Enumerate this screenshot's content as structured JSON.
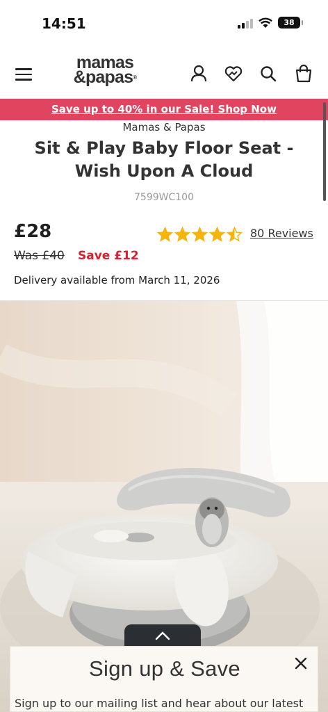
{
  "status_bar": {
    "time": "14:51",
    "battery": "38"
  },
  "header": {
    "logo_line1": "mamas",
    "logo_line2": "&papas",
    "icons": [
      "menu-icon",
      "account-icon",
      "wishlist-icon",
      "search-icon",
      "bag-icon"
    ]
  },
  "promo": {
    "text": "Save up to 40% in our Sale! Shop Now",
    "color": "#e0445e"
  },
  "product": {
    "brand": "Mamas & Papas",
    "title": "Sit & Play Baby Floor Seat - Wish Upon A Cloud",
    "sku": "7599WC100",
    "price": "£28",
    "was_price": "Was £40",
    "save_text": "Save £12",
    "rating": 4.5,
    "reviews": "80 Reviews",
    "delivery": "Delivery available from March 11, 2026"
  },
  "colors": {
    "star": "#f5b50c",
    "save": "#d8202f",
    "popup_bg": "#fbf8f3"
  },
  "popup": {
    "title": "Sign up & Save",
    "text": "Sign up to our mailing list and hear about our latest"
  }
}
